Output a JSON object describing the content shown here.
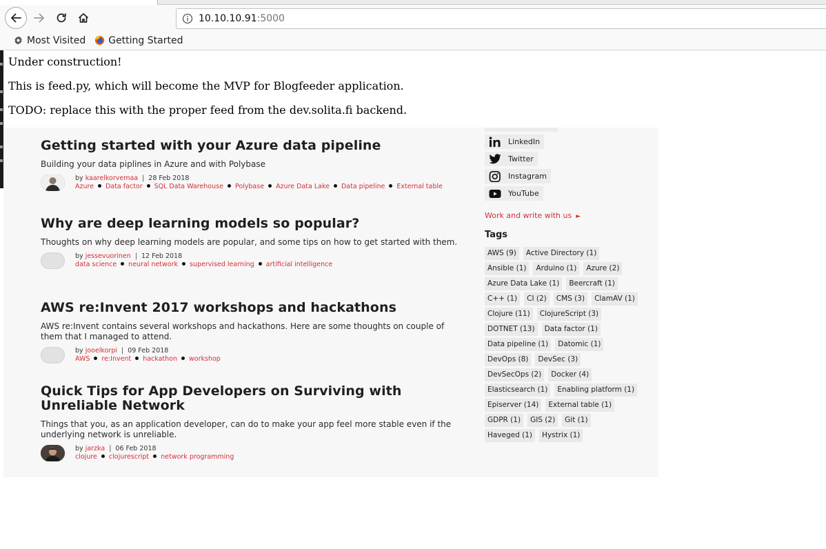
{
  "browser": {
    "url_host": "10.10.10.91",
    "url_port": ":5000",
    "bookmarks": [
      {
        "label": "Most Visited",
        "icon": "gear-icon"
      },
      {
        "label": "Getting Started",
        "icon": "firefox-icon"
      }
    ]
  },
  "page": {
    "lines": [
      "Under construction!",
      "This is feed.py, which will become the MVP for Blogfeeder application.",
      "TODO: replace this with the proper feed from the dev.solita.fi backend."
    ]
  },
  "posts": [
    {
      "title": "Getting started with your Azure data pipeline",
      "description": "Building your data piplines in Azure and with Polybase",
      "by": "by",
      "author": "kaarelkorvemaa",
      "date": "28 Feb 2018",
      "tags": [
        "Azure",
        "Data factor",
        "SQL Data Warehouse",
        "Polybase",
        "Azure Data Lake",
        "Data pipeline",
        "External table"
      ]
    },
    {
      "title": "Why are deep learning models so popular?",
      "description": "Thoughts on why deep learning models are popular, and some tips on how to get started with them.",
      "by": "by",
      "author": "jessevuorinen",
      "date": "12 Feb 2018",
      "tags": [
        "data science",
        "neural network",
        "supervised learning",
        "artificial intelligence"
      ]
    },
    {
      "title": "AWS re:Invent 2017 workshops and hackathons",
      "description": "AWS re:Invent contains several workshops and hackathons. Here are some thoughts on couple of them that I managed to attend.",
      "by": "by",
      "author": "jooelkorpi",
      "date": "09 Feb 2018",
      "tags": [
        "AWS",
        "re:Invent",
        "hackathon",
        "workshop"
      ]
    },
    {
      "title": "Quick Tips for App Developers on Surviving with Unreliable Network",
      "description": "Things that you, as an application developer, can do to make your app feel more stable even if the underlying network is unreliable.",
      "by": "by",
      "author": "jarzka",
      "date": "06 Feb 2018",
      "tags": [
        "clojure",
        "clojurescript",
        "network programming"
      ]
    }
  ],
  "sidebar": {
    "social": [
      {
        "label": "LinkedIn",
        "icon": "linkedin-icon"
      },
      {
        "label": "Twitter",
        "icon": "twitter-icon"
      },
      {
        "label": "Instagram",
        "icon": "instagram-icon"
      },
      {
        "label": "YouTube",
        "icon": "youtube-icon"
      }
    ],
    "work_link": "Work and write with us",
    "tags_heading": "Tags",
    "tags": [
      "AWS (9)",
      "Active Directory (1)",
      "Ansible (1)",
      "Arduino (1)",
      "Azure (2)",
      "Azure Data Lake (1)",
      "Beercraft (1)",
      "C++ (1)",
      "CI (2)",
      "CMS (3)",
      "ClamAV (1)",
      "Clojure (11)",
      "ClojureScript (3)",
      "DOTNET (13)",
      "Data factor (1)",
      "Data pipeline (1)",
      "Datomic (1)",
      "DevOps (8)",
      "DevSec (3)",
      "DevSecOps (2)",
      "Docker (4)",
      "Elasticsearch (1)",
      "Enabling platform (1)",
      "Episerver (14)",
      "External table (1)",
      "GDPR (1)",
      "GIS (2)",
      "Git (1)",
      "Haveged (1)",
      "Hystrix (1)"
    ]
  },
  "colors": {
    "accent": "#d32f37",
    "card_bg": "#f7f7f7",
    "chip_bg": "#e9e9e9"
  }
}
